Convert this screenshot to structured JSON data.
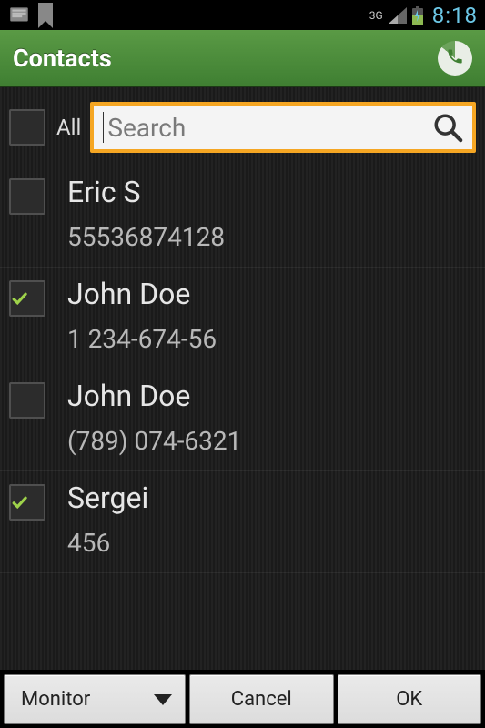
{
  "status": {
    "network_label": "3G",
    "time": "8:18"
  },
  "header": {
    "title": "Contacts"
  },
  "search": {
    "all_label": "All",
    "placeholder": "Search",
    "value": ""
  },
  "contacts": [
    {
      "name": "Eric S",
      "number": "55536874128",
      "checked": false
    },
    {
      "name": "John Doe",
      "number": "1 234-674-56",
      "checked": true
    },
    {
      "name": "John Doe",
      "number": "(789) 074-6321",
      "checked": false
    },
    {
      "name": "Sergei",
      "number": "456",
      "checked": true
    }
  ],
  "footer": {
    "dropdown_label": "Monitor",
    "cancel_label": "Cancel",
    "ok_label": "OK"
  },
  "colors": {
    "accent_green": "#4a8f38",
    "search_border": "#f5a623",
    "time_blue": "#6cc7e6",
    "check_green": "#9ed24a"
  }
}
